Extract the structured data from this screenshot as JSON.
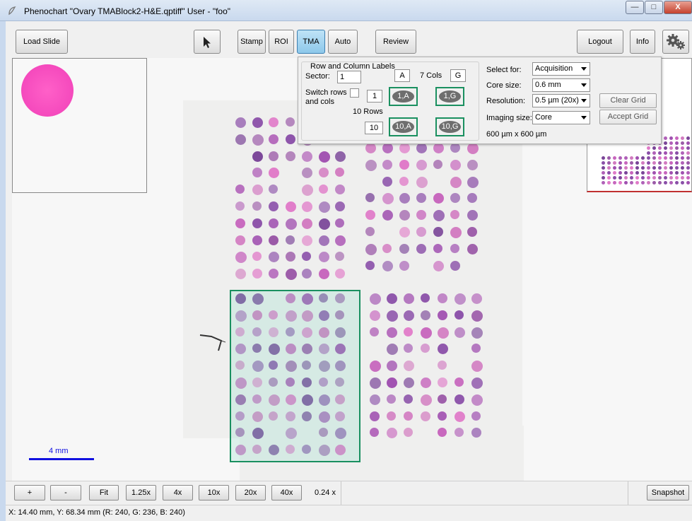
{
  "window": {
    "title": "Phenochart \"Ovary TMABlock2-H&E.qptiff\"  User - \"foo\"",
    "controls": {
      "minimize": "—",
      "maximize": "□",
      "close": "X"
    }
  },
  "toolbar": {
    "load_slide": "Load Slide",
    "stamp": "Stamp",
    "roi": "ROI",
    "tma": "TMA",
    "auto": "Auto",
    "review": "Review",
    "logout": "Logout",
    "info": "Info",
    "pointer_icon": "cursor-arrow-icon",
    "settings_icon": "gears-icon",
    "active_tool": "TMA"
  },
  "tma_panel": {
    "group_title": "Row and Column Labels",
    "sector_label": "Sector:",
    "sector_value": "1",
    "col_start": "A",
    "cols_label": "7 Cols",
    "col_end": "G",
    "switch_label_line1": "Switch rows",
    "switch_label_line2": "and cols",
    "switch_checked": false,
    "row_start": "1",
    "rows_label": "10 Rows",
    "row_end": "10",
    "corners": {
      "top_left": "1,A",
      "top_right": "1,G",
      "bottom_left": "10,A",
      "bottom_right": "10,G"
    },
    "select_for_label": "Select for:",
    "select_for_value": "Acquisition",
    "core_size_label": "Core size:",
    "core_size_value": "0.6 mm",
    "resolution_label": "Resolution:",
    "resolution_value": "0.5 µm (20x)",
    "imaging_size_label": "Imaging size:",
    "imaging_size_value": "Core",
    "field_size": "600 µm x 600 µm",
    "clear_grid": "Clear Grid",
    "accept_grid": "Accept Grid"
  },
  "viewer": {
    "scale_label": "4 mm",
    "colors": {
      "core_purple": "#8a4fa8",
      "core_pink": "#e07ac8",
      "selection": "#1a9060"
    }
  },
  "zoom_bar": {
    "plus": "+",
    "minus": "-",
    "fit": "Fit",
    "levels": [
      "1.25x",
      "4x",
      "10x",
      "20x",
      "40x"
    ],
    "current": "0.24 x",
    "snapshot": "Snapshot"
  },
  "status": {
    "text": "X: 14.40 mm, Y: 68.34 mm (R: 240, G: 236, B: 240)"
  }
}
